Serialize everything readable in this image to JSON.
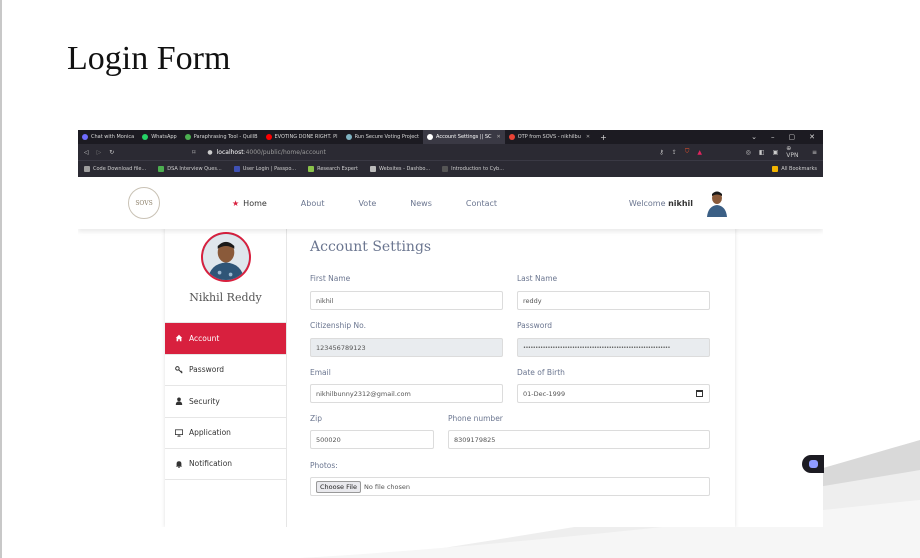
{
  "slide": {
    "title": "Login Form"
  },
  "browser": {
    "tabs": [
      {
        "label": "Chat with Monica",
        "color": "#6f6cff"
      },
      {
        "label": "WhatsApp",
        "color": "#25d366"
      },
      {
        "label": "Paraphrasing Tool - QuillB",
        "color": "#4caf50"
      },
      {
        "label": "EVOTING DONE RIGHT. Pl",
        "color": "#ff0000"
      },
      {
        "label": "Run Secure Voting Project",
        "color": "#7fb3c2"
      },
      {
        "label": "Account Settings || SC",
        "color": "#ffffff",
        "active": true
      },
      {
        "label": "OTP from SOVS - nikhilbu",
        "color": "#ea4335"
      }
    ],
    "url_host": "localhost",
    "url_path": ":4000/public/home/account",
    "vpn_label": "VPN",
    "bookmarks": [
      {
        "label": "Code Download file...",
        "color": "#9e9e9e"
      },
      {
        "label": "DSA Interview Ques...",
        "color": "#4caf50"
      },
      {
        "label": "User Login | Passpo...",
        "color": "#3f51b5"
      },
      {
        "label": "Research Expert",
        "color": "#8bc34a"
      },
      {
        "label": "Websites - Dashbo...",
        "color": "#bbbbbb"
      },
      {
        "label": "Introduction to Cyb...",
        "color": "#555555"
      }
    ],
    "all_bookmarks": "All Bookmarks"
  },
  "site": {
    "logo_text": "SOVS",
    "nav": [
      "Home",
      "About",
      "Vote",
      "News",
      "Contact"
    ],
    "welcome_prefix": "Welcome",
    "welcome_user": "nikhil",
    "accent": "#d8203e"
  },
  "profile": {
    "name": "Nikhil Reddy"
  },
  "sidebar": {
    "items": [
      {
        "label": "Account",
        "icon": "home-icon"
      },
      {
        "label": "Password",
        "icon": "key-icon"
      },
      {
        "label": "Security",
        "icon": "user-icon"
      },
      {
        "label": "Application",
        "icon": "monitor-icon"
      },
      {
        "label": "Notification",
        "icon": "bell-icon"
      }
    ]
  },
  "form": {
    "title": "Account Settings",
    "first_name_label": "First Name",
    "first_name": "nikhil",
    "last_name_label": "Last Name",
    "last_name": "reddy",
    "citizenship_label": "Citizenship No.",
    "citizenship": "123456789123",
    "password_label": "Password",
    "password": "••••••••••••••••••••••••••••••••••••••••••••••••••••••••••••",
    "email_label": "Email",
    "email": "nikhilbunny2312@gmail.com",
    "dob_label": "Date of Birth",
    "dob": "01-Dec-1999",
    "zip_label": "Zip",
    "zip": "500020",
    "phone_label": "Phone number",
    "phone": "8309179825",
    "photos_label": "Photos:",
    "choose_file": "Choose File",
    "no_file": "No file chosen"
  }
}
